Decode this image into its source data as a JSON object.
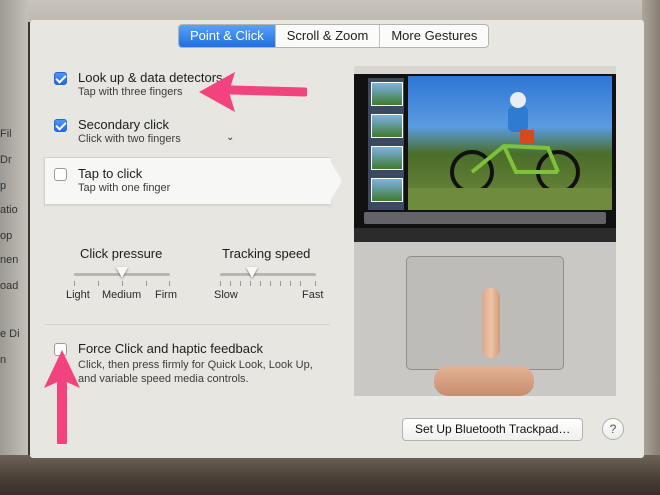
{
  "tabs": [
    {
      "label": "Point & Click",
      "active": true
    },
    {
      "label": "Scroll & Zoom",
      "active": false
    },
    {
      "label": "More Gestures",
      "active": false
    }
  ],
  "options": [
    {
      "title": "Look up & data detectors",
      "subtitle": "Tap with three fingers",
      "checked": true
    },
    {
      "title": "Secondary click",
      "subtitle": "Click with two fingers",
      "checked": true
    },
    {
      "title": "Tap to click",
      "subtitle": "Tap with one finger",
      "checked": false
    }
  ],
  "sliders": {
    "click_pressure": {
      "title": "Click pressure",
      "labels": [
        "Light",
        "Medium",
        "Firm"
      ],
      "level": 0.5
    },
    "tracking_speed": {
      "title": "Tracking speed",
      "labels": [
        "Slow",
        "Fast"
      ],
      "level": 0.33
    }
  },
  "force_click": {
    "title": "Force Click and haptic feedback",
    "description": [
      "Click, then press firmly for Quick Look, Look Up,",
      "and variable speed media controls."
    ],
    "checked": false
  },
  "buttons": {
    "bluetooth": "Set Up Bluetooth Trackpad…",
    "help": "?"
  },
  "background_window": {
    "labels": [
      "Fil",
      "Dr",
      "p",
      "atio",
      "op",
      "nen",
      "oad",
      "e Di",
      "n"
    ]
  },
  "colors": {
    "accent": "#2a74e6",
    "annotation_arrow": "#f2437f"
  }
}
